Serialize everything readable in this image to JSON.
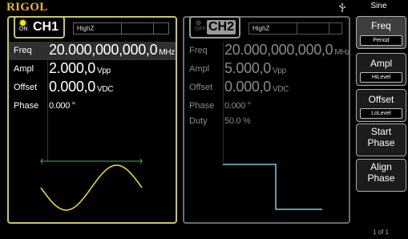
{
  "header": {
    "brand": "RIGOL",
    "mode": "Sine",
    "usb_icon": "usb-icon"
  },
  "ch1": {
    "status": "ON",
    "name": "CH1",
    "impedance": "HighZ",
    "params": {
      "freq": {
        "label": "Freq",
        "value": "20.000,000,000,0",
        "unit": "MHz"
      },
      "ampl": {
        "label": "Ampl",
        "value": "2.000,0",
        "unit": "Vpp"
      },
      "offset": {
        "label": "Offset",
        "value": "0.000,0",
        "unit": "VDC"
      },
      "phase": {
        "label": "Phase",
        "value": "0.000 °"
      }
    },
    "waveform": "sine",
    "color": "#f2e21a"
  },
  "ch2": {
    "status": "OFF",
    "name": "CH2",
    "impedance": "HighZ",
    "params": {
      "freq": {
        "label": "Freq",
        "value": "20.000,000,000,0",
        "unit": "MHz"
      },
      "ampl": {
        "label": "Ampl",
        "value": "5.000,0",
        "unit": "Vpp"
      },
      "offset": {
        "label": "Offset",
        "value": "0.000,0",
        "unit": "VDC"
      },
      "phase": {
        "label": "Phase",
        "value": "0.000 °"
      },
      "duty": {
        "label": "Duty",
        "value": "50.0 %"
      }
    },
    "waveform": "square",
    "color": "#7ec8e3"
  },
  "menu": {
    "k1": {
      "label": "Freq",
      "sub": "Period"
    },
    "k2": {
      "label": "Ampl",
      "sub": "HiLevel"
    },
    "k3": {
      "label": "Offset",
      "sub": "LoLevel"
    },
    "k4": {
      "label": "Start Phase"
    },
    "k5": {
      "label": "Align Phase"
    }
  },
  "page_indicator": "1 of 1"
}
